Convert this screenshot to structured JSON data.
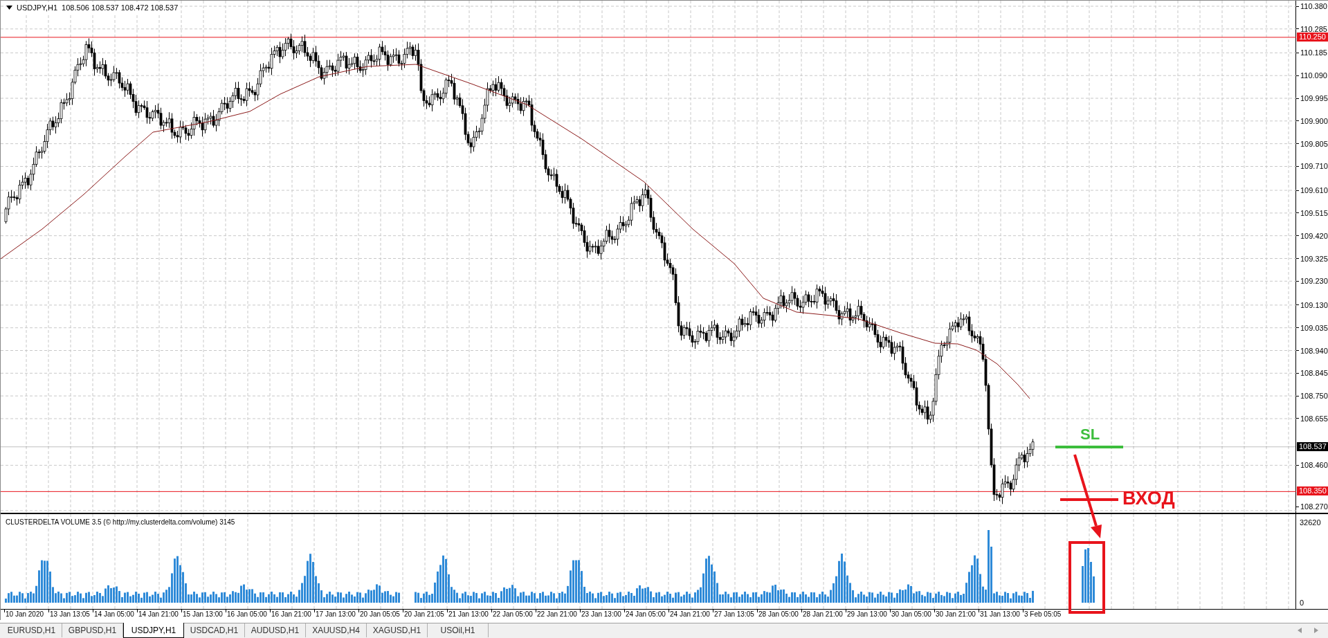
{
  "chart": {
    "symbol": "USDJPY,H1",
    "ohlc": "108.506 108.537 108.472 108.537"
  },
  "price_axis": {
    "labels": [
      "110.380",
      "110.285",
      "110.185",
      "110.090",
      "109.995",
      "109.900",
      "109.805",
      "109.710",
      "109.610",
      "109.515",
      "109.420",
      "109.325",
      "109.230",
      "109.130",
      "109.035",
      "108.940",
      "108.845",
      "108.750",
      "108.655",
      "108.460",
      "108.270"
    ],
    "markers": [
      {
        "text": "110.250",
        "color": "#e8141c"
      },
      {
        "text": "108.537",
        "color": "#000000"
      },
      {
        "text": "108.350",
        "color": "#e8141c"
      }
    ]
  },
  "annotations": [
    {
      "kind": "stop",
      "text": "SL",
      "color": "#3cbd3c"
    },
    {
      "kind": "entry",
      "text": "ВХОД",
      "color": "#e8141c"
    }
  ],
  "volume_pane": {
    "title": "CLUSTERDELTA VOLUME 3.5 (© http://my.clusterdelta.com/volume) 3145",
    "max_label": "32620",
    "min_label": "0"
  },
  "time_axis": [
    "10 Jan 2020",
    "13 Jan 13:05",
    "14 Jan 05:00",
    "14 Jan 21:00",
    "15 Jan 13:00",
    "16 Jan 05:00",
    "16 Jan 21:00",
    "17 Jan 13:00",
    "20 Jan 05:05",
    "20 Jan 21:05",
    "21 Jan 13:00",
    "22 Jan 05:00",
    "22 Jan 21:00",
    "23 Jan 13:00",
    "24 Jan 05:00",
    "24 Jan 21:00",
    "27 Jan 13:05",
    "28 Jan 05:00",
    "28 Jan 21:00",
    "29 Jan 13:00",
    "30 Jan 05:00",
    "30 Jan 21:00",
    "31 Jan 13:00",
    "3 Feb 05:05"
  ],
  "tabs": [
    {
      "label": "EURUSD,H1",
      "selected": false
    },
    {
      "label": "GBPUSD,H1",
      "selected": false
    },
    {
      "label": "USDJPY,H1",
      "selected": true
    },
    {
      "label": "USDCAD,H1",
      "selected": false
    },
    {
      "label": "AUDUSD,H1",
      "selected": false
    },
    {
      "label": "XAUUSD,H4",
      "selected": false
    },
    {
      "label": "XAGUSD,H1",
      "selected": false
    },
    {
      "label": "USOil,H1",
      "selected": false
    }
  ]
}
